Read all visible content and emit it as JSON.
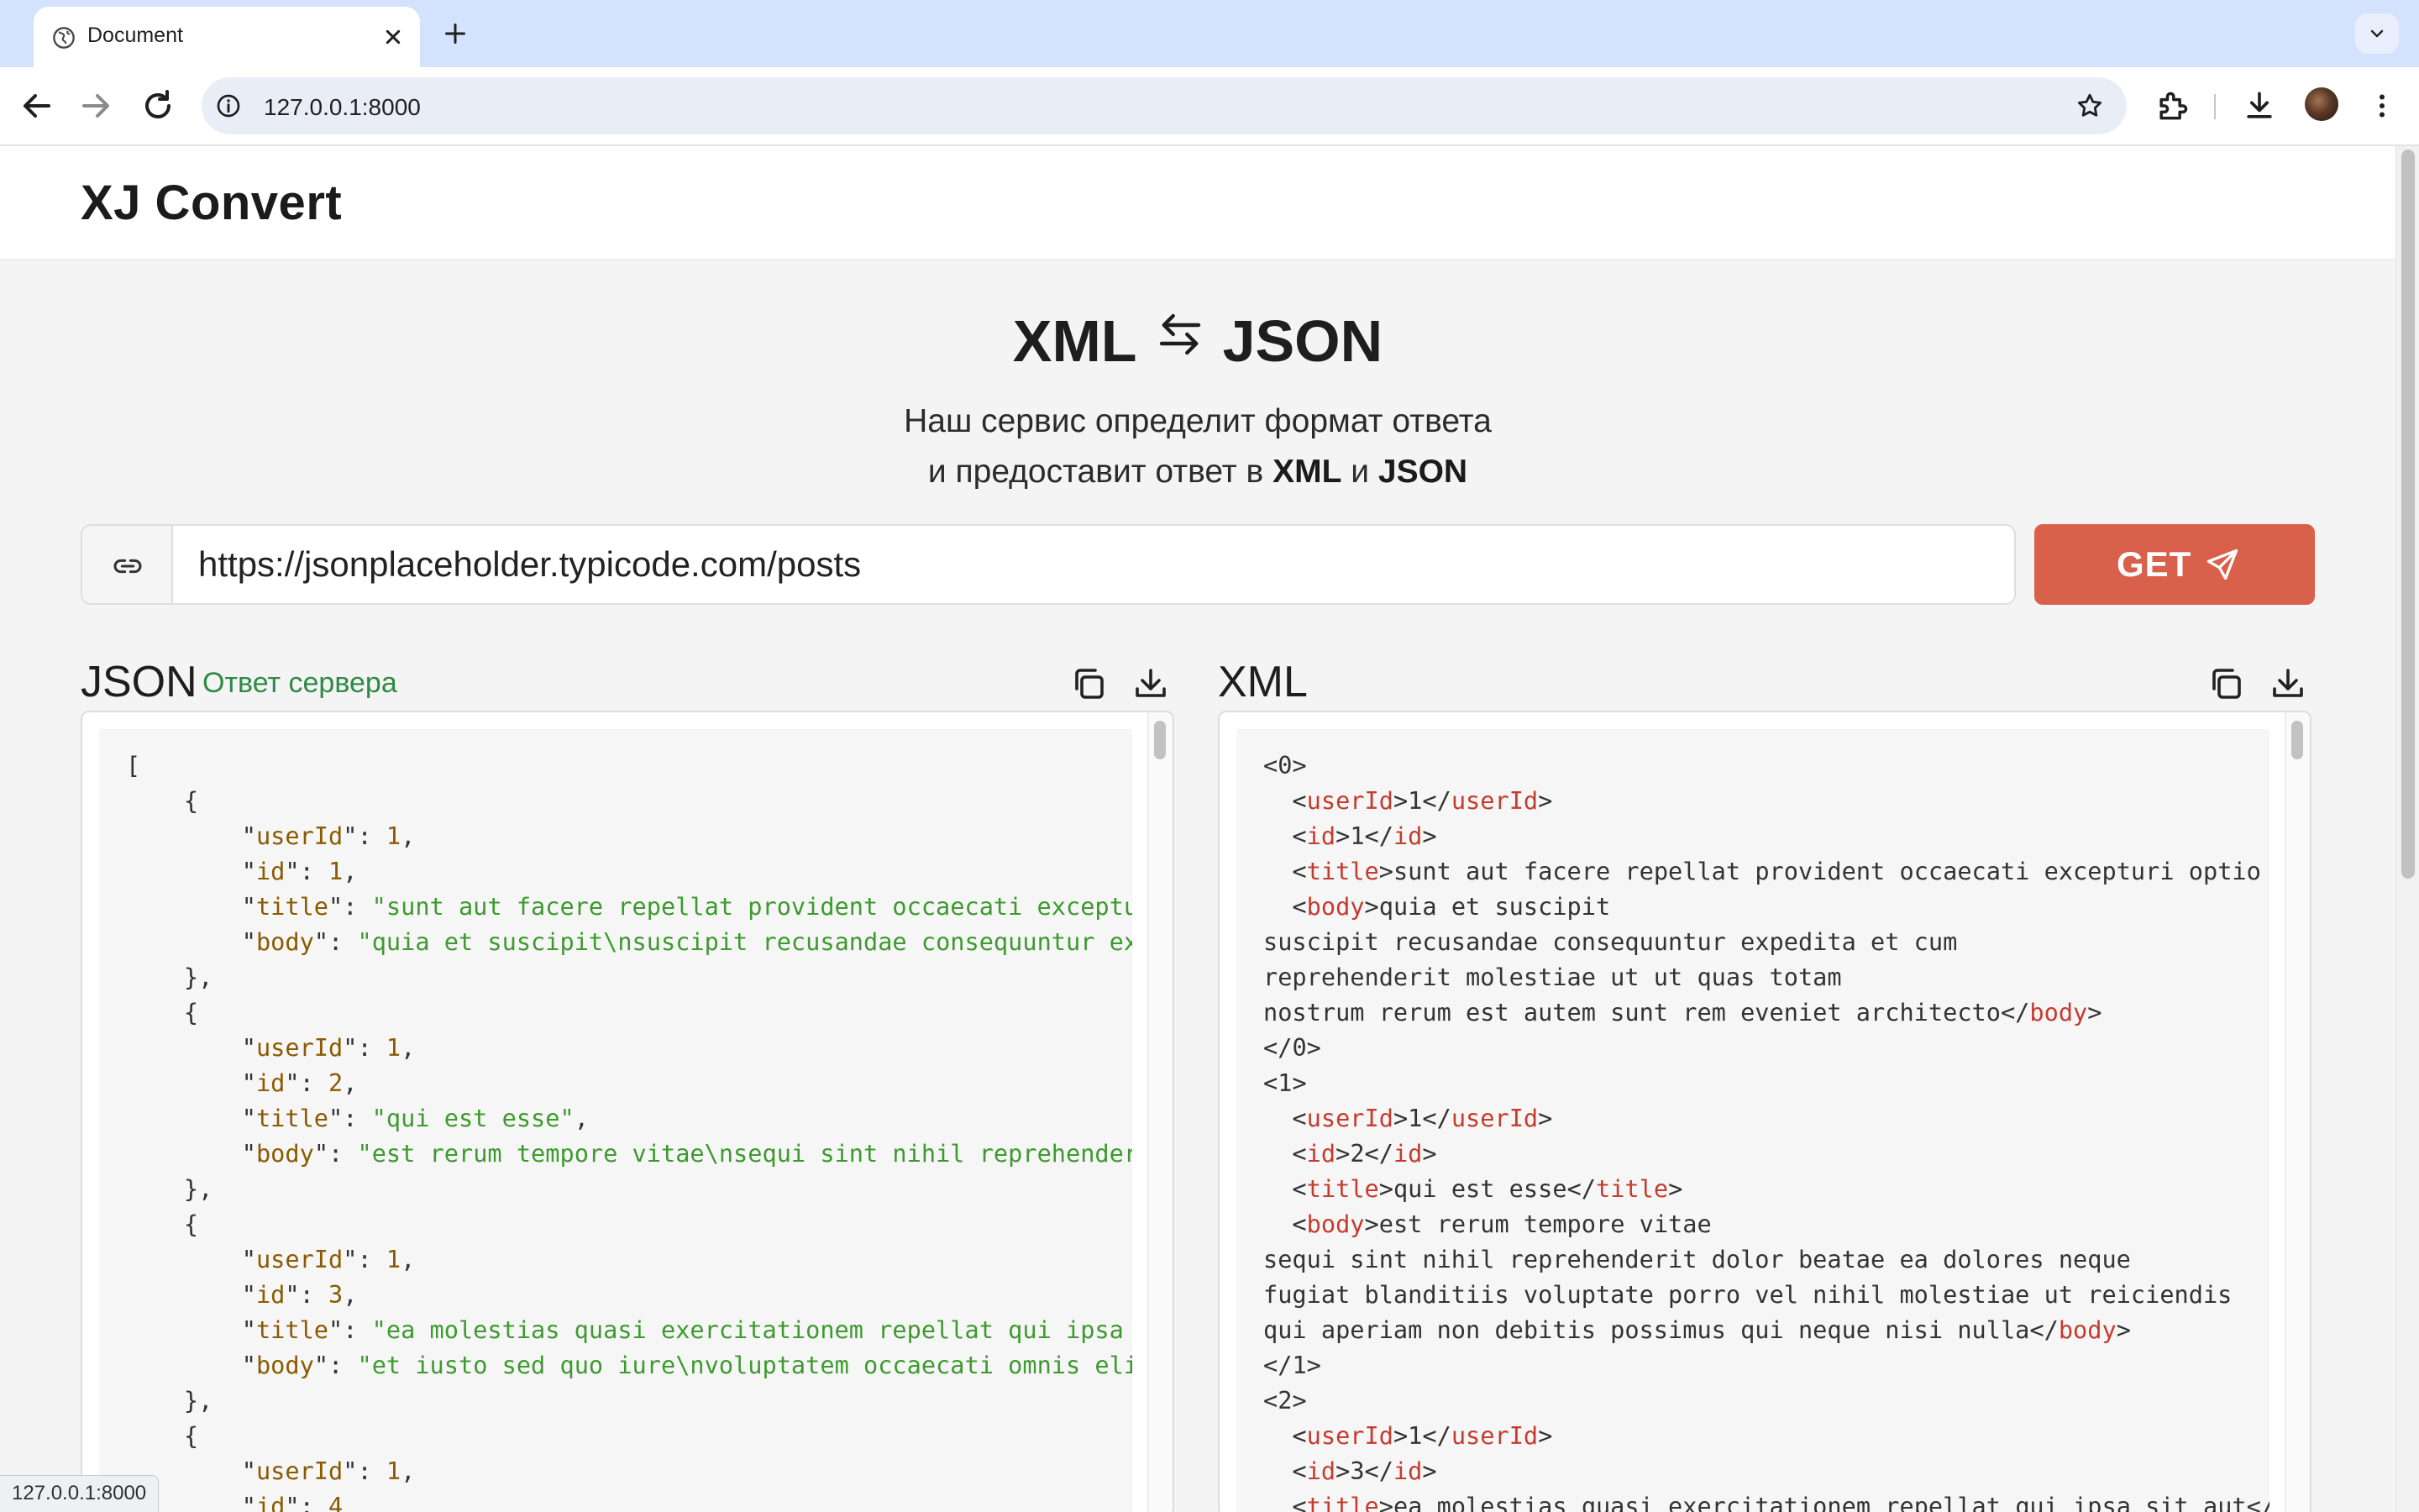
{
  "browser": {
    "tab_title": "Document",
    "url": "127.0.0.1:8000",
    "status_url": "127.0.0.1:8000"
  },
  "site": {
    "logo": "XJ Convert",
    "hero": {
      "title_left": "XML",
      "title_right": "JSON",
      "subtitle_line1": "Наш сервис определит формат ответа",
      "subtitle_line2_prefix": "и предоставит ответ в",
      "subtitle_xml": "XML",
      "subtitle_and": "и",
      "subtitle_json": "JSON"
    },
    "request": {
      "url_value": "https://jsonplaceholder.typicode.com/posts",
      "get_label": "GET"
    },
    "json_panel": {
      "label": "JSON",
      "status": "Ответ сервера"
    },
    "xml_panel": {
      "label": "XML"
    }
  },
  "json_posts": [
    {
      "userId": "1",
      "id": "1",
      "title": "sunt aut facere repellat provident occaecati exceptur",
      "body": "quia et suscipit\\nsuscipit recusandae consequuntur expe"
    },
    {
      "userId": "1",
      "id": "2",
      "title": "qui est esse",
      "body": "est rerum tempore vitae\\nsequi sint nihil reprehenderit"
    },
    {
      "userId": "1",
      "id": "3",
      "title": "ea molestias quasi exercitationem repellat qui ipsa si",
      "body": "et iusto sed quo iure\\nvoluptatem occaecati omnis elige"
    },
    {
      "userId": "1",
      "id": "4"
    }
  ],
  "xml_posts": [
    {
      "index": "0",
      "userId": "1",
      "id": "1",
      "title": "sunt aut facere repellat provident occaecati excepturi optio re",
      "body_lines": [
        "quia et suscipit",
        "suscipit recusandae consequuntur expedita et cum",
        "reprehenderit molestiae ut ut quas totam",
        "nostrum rerum est autem sunt rem eveniet architecto"
      ]
    },
    {
      "index": "1",
      "userId": "1",
      "id": "2",
      "title": "qui est esse",
      "body_lines": [
        "est rerum tempore vitae",
        "sequi sint nihil reprehenderit dolor beatae ea dolores neque",
        "fugiat blanditiis voluptate porro vel nihil molestiae ut reiciendis",
        "qui aperiam non debitis possimus qui neque nisi nulla"
      ]
    },
    {
      "index": "2",
      "userId": "1",
      "id": "3",
      "title": "ea molestias quasi exercitationem repellat qui ipsa sit aut"
    }
  ],
  "colors": {
    "accent": "#d9604a",
    "status_green": "#2f8a47",
    "json_key": "#8a5a00",
    "json_string": "#3d9a2e",
    "xml_tag": "#c53b2e"
  },
  "icons": {
    "url_field": "link-icon",
    "get_button": "send-icon",
    "copy": "copy-icon",
    "download": "download-icon",
    "hero": "swap-arrows-icon"
  }
}
